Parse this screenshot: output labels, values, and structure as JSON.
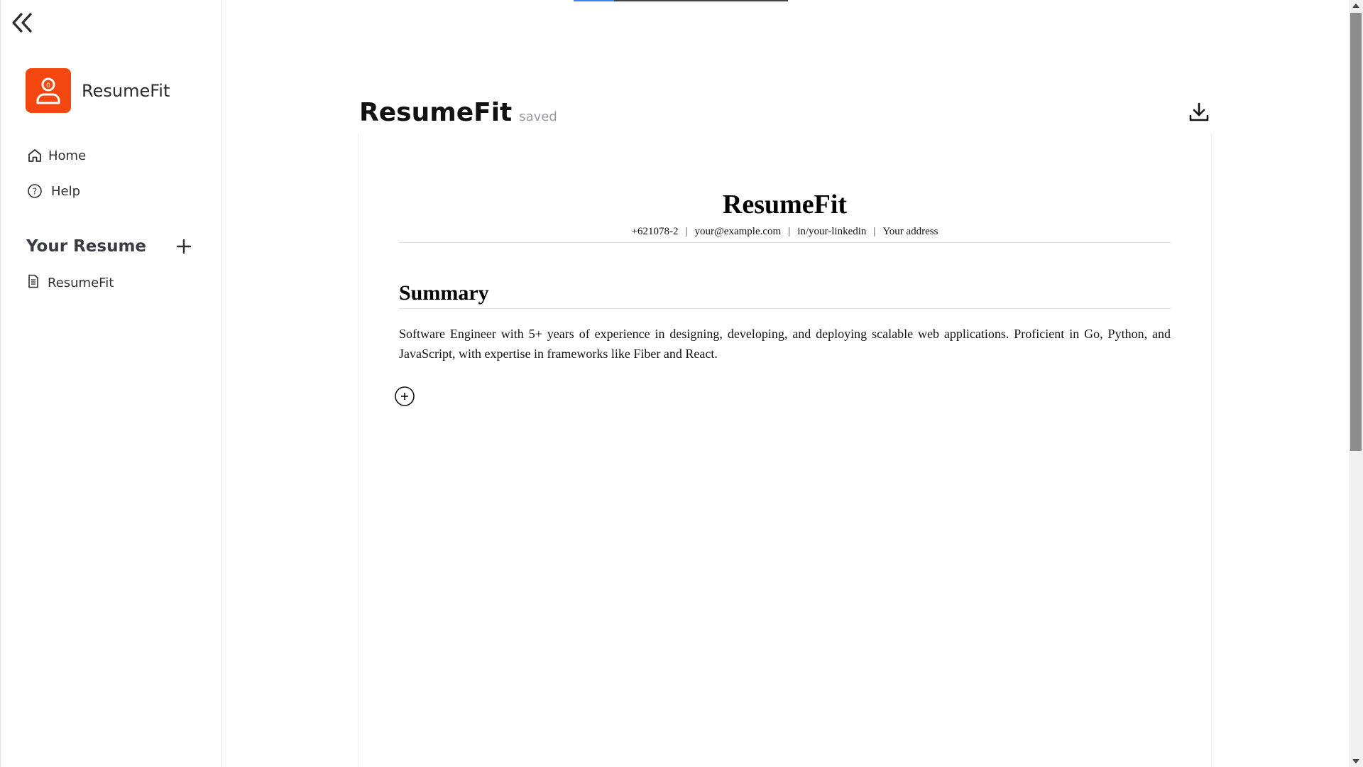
{
  "sidebar": {
    "brand_name": "ResumeFit",
    "brand_color": "#f4470f",
    "nav": [
      {
        "label": "Home",
        "icon": "home-icon"
      },
      {
        "label": "Help",
        "icon": "help-circle-icon"
      }
    ],
    "section_title": "Your Resume",
    "resumes": [
      {
        "label": "ResumeFit",
        "icon": "document-icon"
      }
    ]
  },
  "progress": {
    "fraction": 0.19,
    "fill_color": "#3b82f6"
  },
  "header": {
    "title": "ResumeFit",
    "status": "saved"
  },
  "resume": {
    "name": "ResumeFit",
    "contact": [
      "+621078-2",
      "your@example.com",
      "in/your-linkedin",
      "Your address"
    ],
    "contact_separator": "|",
    "sections": [
      {
        "heading": "Summary",
        "body": "Software Engineer with 5+ years of experience in designing, developing, and deploying scalable web applications. Proficient in Go, Python, and JavaScript, with expertise in frameworks like Fiber and React."
      }
    ]
  }
}
